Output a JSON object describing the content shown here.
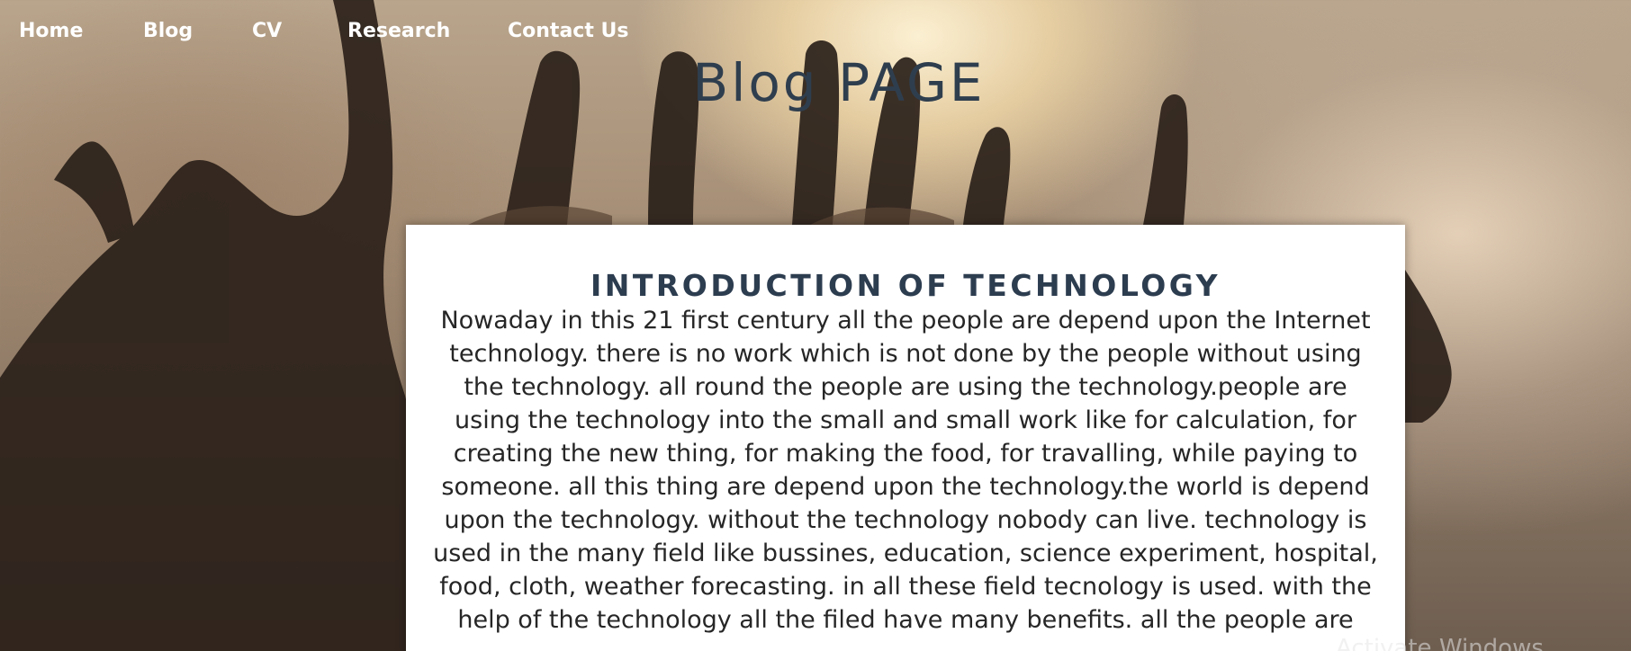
{
  "nav": {
    "items": [
      {
        "label": "Home"
      },
      {
        "label": "Blog"
      },
      {
        "label": "CV"
      },
      {
        "label": "Research"
      },
      {
        "label": "Contact Us"
      }
    ]
  },
  "page": {
    "title": "Blog PAGE"
  },
  "article": {
    "heading": "INTRODUCTION OF TECHNOLOGY",
    "body": "Nowaday in this 21 first century all the people are depend upon the Internet technology. there is no work which is not done by the people without using the technology. all round the people are using the technology.people are using the technology into the small and small work like for calculation, for creating the new thing, for making the food, for travalling, while paying to someone. all this thing are depend upon the technology.the world is depend upon the technology. without the technology nobody can live. technology is used in the many field like bussines, education, science experiment, hospital, food, cloth, weather forecasting. in all these field tecnology is used. with the help of the technology all the filed have many benefits. all the people are"
  },
  "overlay": {
    "watermark": "Activate Windows"
  }
}
